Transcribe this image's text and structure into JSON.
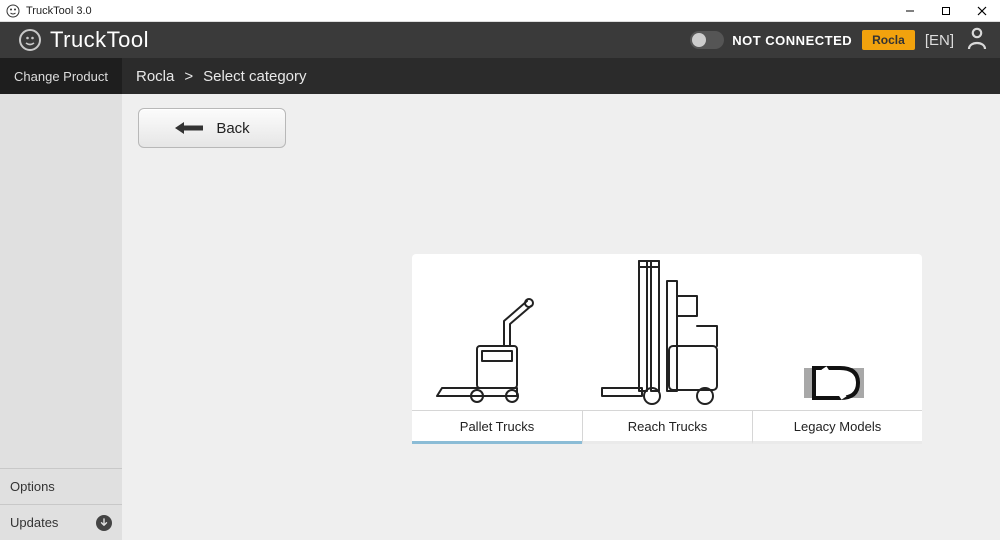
{
  "window": {
    "title": "TruckTool 3.0"
  },
  "header": {
    "app_name": "TruckTool",
    "status_label": "NOT CONNECTED",
    "brand_button": "Rocla",
    "language": "[EN]"
  },
  "subheader": {
    "change_product": "Change Product",
    "breadcrumb": {
      "root": "Rocla",
      "sep": ">",
      "current": "Select category"
    }
  },
  "sidebar": {
    "options": "Options",
    "updates": "Updates"
  },
  "main": {
    "back_label": "Back",
    "categories": [
      {
        "label": "Pallet Trucks",
        "selected": true
      },
      {
        "label": "Reach Trucks",
        "selected": false
      },
      {
        "label": "Legacy Models",
        "selected": false
      }
    ]
  }
}
